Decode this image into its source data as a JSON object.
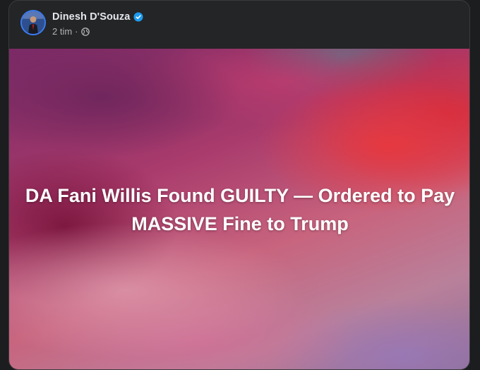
{
  "post": {
    "author_name": "Dinesh D'Souza",
    "timestamp": "2 tim",
    "separator": "·",
    "verified_icon": "verified-badge-icon",
    "privacy_icon": "globe-icon",
    "image_headline": "DA Fani Willis Found GUILTY — Ordered to Pay MASSIVE Fine to Trump"
  },
  "colors": {
    "background": "#1c1d1f",
    "card": "#242526",
    "name_text": "#e4e6eb",
    "meta_text": "#b0b3b8",
    "verified_blue": "#1d9bf0"
  }
}
